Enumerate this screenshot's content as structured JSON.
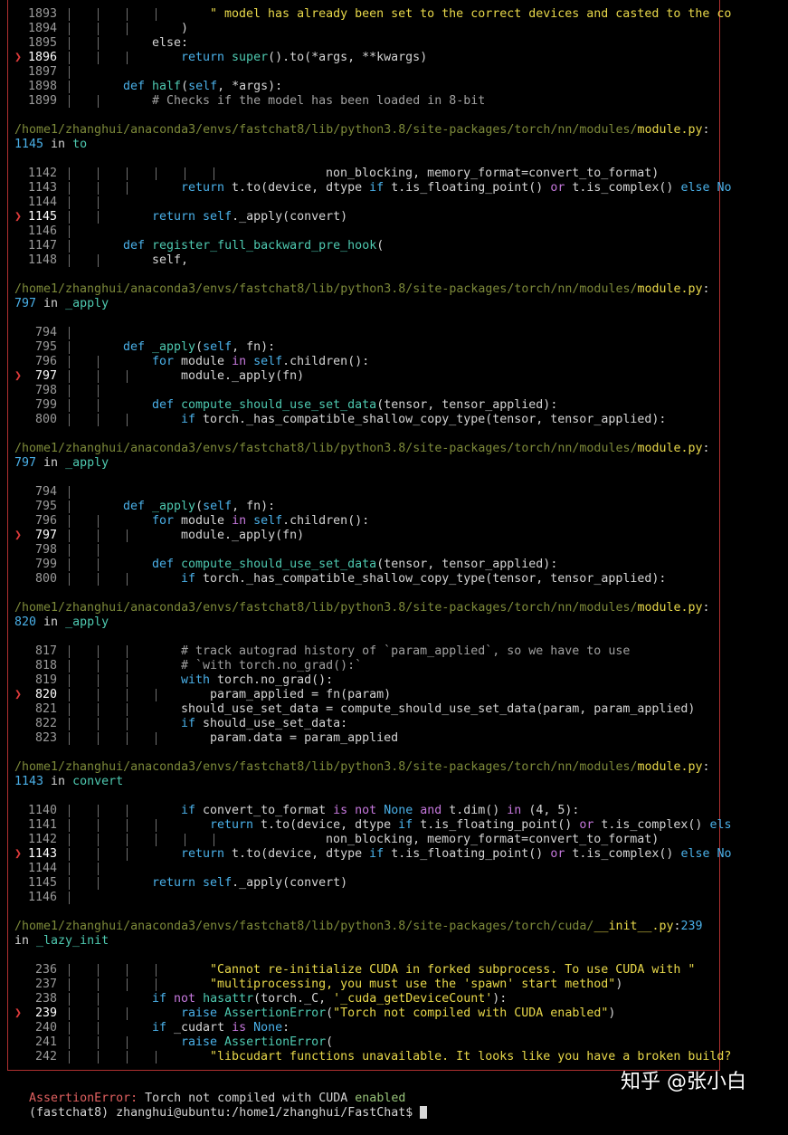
{
  "colors": {
    "background": "#000000",
    "frame": "#b03030",
    "path": "#7d8a3a",
    "filename": "#e8d84a",
    "keyword": "#4ab0e8",
    "error": "#e06060"
  },
  "frames": [
    {
      "lines": [
        {
          "n": "1893",
          "cur": false,
          "depth": 4,
          "indent": 20,
          "code": [
            [
              "\" model has already been set to the correct devices and casted to the co",
              "str"
            ]
          ]
        },
        {
          "n": "1894",
          "cur": false,
          "depth": 3,
          "indent": 16,
          "code": [
            [
              ")",
              ""
            ]
          ]
        },
        {
          "n": "1895",
          "cur": false,
          "depth": 2,
          "indent": 12,
          "code": [
            [
              "else",
              ""
            ],
            [
              ":",
              ""
            ]
          ]
        },
        {
          "n": "1896",
          "cur": true,
          "depth": 3,
          "indent": 16,
          "code": [
            [
              "return ",
              "kw"
            ],
            [
              "super",
              "fn"
            ],
            [
              "().to(*args, **kwargs)",
              ""
            ]
          ]
        },
        {
          "n": "1897",
          "cur": false,
          "depth": 1,
          "indent": 0,
          "code": []
        },
        {
          "n": "1898",
          "cur": false,
          "depth": 1,
          "indent": 8,
          "code": [
            [
              "def ",
              "kw"
            ],
            [
              "half",
              "fn"
            ],
            [
              "(",
              ""
            ],
            [
              "self",
              "kw"
            ],
            [
              ", *args):",
              ""
            ]
          ]
        },
        {
          "n": "1899",
          "cur": false,
          "depth": 2,
          "indent": 12,
          "code": [
            [
              "# Checks if the model has been loaded in 8-bit",
              "cmt"
            ]
          ]
        }
      ]
    },
    {
      "path": "/home1/zhanghui/anaconda3/envs/fastchat8/lib/python3.8/site-packages/torch/nn/modules/",
      "file": "module.py",
      "lineno": "1145",
      "func": "to",
      "lines": [
        {
          "n": "1142",
          "cur": false,
          "depth": 6,
          "indent": 36,
          "code": [
            [
              "non_blocking, memory_format=convert_to_format)",
              ""
            ]
          ]
        },
        {
          "n": "1143",
          "cur": false,
          "depth": 3,
          "indent": 16,
          "code": [
            [
              "return ",
              "kw"
            ],
            [
              "t.to(device, dtype ",
              ""
            ],
            [
              "if ",
              "kw"
            ],
            [
              "t.is_floating_point() ",
              ""
            ],
            [
              "or ",
              "kwp"
            ],
            [
              "t.is_complex() ",
              ""
            ],
            [
              "else No",
              "kw"
            ]
          ]
        },
        {
          "n": "1144",
          "cur": false,
          "depth": 2,
          "indent": 0,
          "code": []
        },
        {
          "n": "1145",
          "cur": true,
          "depth": 2,
          "indent": 12,
          "code": [
            [
              "return ",
              "kw"
            ],
            [
              "self",
              "kw"
            ],
            [
              "._apply(convert)",
              ""
            ]
          ]
        },
        {
          "n": "1146",
          "cur": false,
          "depth": 1,
          "indent": 0,
          "code": []
        },
        {
          "n": "1147",
          "cur": false,
          "depth": 1,
          "indent": 8,
          "code": [
            [
              "def ",
              "kw"
            ],
            [
              "register_full_backward_pre_hook",
              "fn"
            ],
            [
              "(",
              ""
            ]
          ]
        },
        {
          "n": "1148",
          "cur": false,
          "depth": 2,
          "indent": 12,
          "code": [
            [
              "self",
              ""
            ],
            [
              ",",
              ""
            ]
          ]
        }
      ]
    },
    {
      "path": "/home1/zhanghui/anaconda3/envs/fastchat8/lib/python3.8/site-packages/torch/nn/modules/",
      "file": "module.py",
      "lineno": "797",
      "func": "_apply",
      "lines": [
        {
          "n": "794",
          "cur": false,
          "depth": 1,
          "indent": 0,
          "code": []
        },
        {
          "n": "795",
          "cur": false,
          "depth": 1,
          "indent": 8,
          "code": [
            [
              "def ",
              "kw"
            ],
            [
              "_apply",
              "fn"
            ],
            [
              "(",
              ""
            ],
            [
              "self",
              "kw"
            ],
            [
              ", fn):",
              ""
            ]
          ]
        },
        {
          "n": "796",
          "cur": false,
          "depth": 2,
          "indent": 12,
          "code": [
            [
              "for ",
              "kw"
            ],
            [
              "module ",
              ""
            ],
            [
              "in ",
              "kwp"
            ],
            [
              "self",
              "kw"
            ],
            [
              ".children():",
              ""
            ]
          ]
        },
        {
          "n": "797",
          "cur": true,
          "depth": 3,
          "indent": 16,
          "code": [
            [
              "module._apply(fn)",
              ""
            ]
          ]
        },
        {
          "n": "798",
          "cur": false,
          "depth": 2,
          "indent": 0,
          "code": []
        },
        {
          "n": "799",
          "cur": false,
          "depth": 2,
          "indent": 12,
          "code": [
            [
              "def ",
              "kw"
            ],
            [
              "compute_should_use_set_data",
              "fn"
            ],
            [
              "(tensor, tensor_applied):",
              ""
            ]
          ]
        },
        {
          "n": "800",
          "cur": false,
          "depth": 3,
          "indent": 16,
          "code": [
            [
              "if ",
              "kw"
            ],
            [
              "torch._has_compatible_shallow_copy_type(tensor, tensor_applied):",
              ""
            ]
          ]
        }
      ]
    },
    {
      "path": "/home1/zhanghui/anaconda3/envs/fastchat8/lib/python3.8/site-packages/torch/nn/modules/",
      "file": "module.py",
      "lineno": "797",
      "func": "_apply",
      "lines": [
        {
          "n": "794",
          "cur": false,
          "depth": 1,
          "indent": 0,
          "code": []
        },
        {
          "n": "795",
          "cur": false,
          "depth": 1,
          "indent": 8,
          "code": [
            [
              "def ",
              "kw"
            ],
            [
              "_apply",
              "fn"
            ],
            [
              "(",
              ""
            ],
            [
              "self",
              "kw"
            ],
            [
              ", fn):",
              ""
            ]
          ]
        },
        {
          "n": "796",
          "cur": false,
          "depth": 2,
          "indent": 12,
          "code": [
            [
              "for ",
              "kw"
            ],
            [
              "module ",
              ""
            ],
            [
              "in ",
              "kwp"
            ],
            [
              "self",
              "kw"
            ],
            [
              ".children():",
              ""
            ]
          ]
        },
        {
          "n": "797",
          "cur": true,
          "depth": 3,
          "indent": 16,
          "code": [
            [
              "module._apply(fn)",
              ""
            ]
          ]
        },
        {
          "n": "798",
          "cur": false,
          "depth": 2,
          "indent": 0,
          "code": []
        },
        {
          "n": "799",
          "cur": false,
          "depth": 2,
          "indent": 12,
          "code": [
            [
              "def ",
              "kw"
            ],
            [
              "compute_should_use_set_data",
              "fn"
            ],
            [
              "(tensor, tensor_applied):",
              ""
            ]
          ]
        },
        {
          "n": "800",
          "cur": false,
          "depth": 3,
          "indent": 16,
          "code": [
            [
              "if ",
              "kw"
            ],
            [
              "torch._has_compatible_shallow_copy_type(tensor, tensor_applied):",
              ""
            ]
          ]
        }
      ]
    },
    {
      "path": "/home1/zhanghui/anaconda3/envs/fastchat8/lib/python3.8/site-packages/torch/nn/modules/",
      "file": "module.py",
      "lineno": "820",
      "func": "_apply",
      "lines": [
        {
          "n": "817",
          "cur": false,
          "depth": 3,
          "indent": 16,
          "code": [
            [
              "# track autograd history of `param_applied`, so we have to use",
              "cmt"
            ]
          ]
        },
        {
          "n": "818",
          "cur": false,
          "depth": 3,
          "indent": 16,
          "code": [
            [
              "# `with torch.no_grad():`",
              "cmt"
            ]
          ]
        },
        {
          "n": "819",
          "cur": false,
          "depth": 3,
          "indent": 16,
          "code": [
            [
              "with ",
              "kw"
            ],
            [
              "torch.no_grad():",
              ""
            ]
          ]
        },
        {
          "n": "820",
          "cur": true,
          "depth": 4,
          "indent": 20,
          "code": [
            [
              "param_applied = fn(param)",
              ""
            ]
          ]
        },
        {
          "n": "821",
          "cur": false,
          "depth": 3,
          "indent": 16,
          "code": [
            [
              "should_use_set_data = compute_should_use_set_data(param, param_applied)",
              ""
            ]
          ]
        },
        {
          "n": "822",
          "cur": false,
          "depth": 3,
          "indent": 16,
          "code": [
            [
              "if ",
              "kw"
            ],
            [
              "should_use_set_data:",
              ""
            ]
          ]
        },
        {
          "n": "823",
          "cur": false,
          "depth": 4,
          "indent": 20,
          "code": [
            [
              "param.data = param_applied",
              ""
            ]
          ]
        }
      ]
    },
    {
      "path": "/home1/zhanghui/anaconda3/envs/fastchat8/lib/python3.8/site-packages/torch/nn/modules/",
      "file": "module.py",
      "lineno": "1143",
      "func": "convert",
      "lines": [
        {
          "n": "1140",
          "cur": false,
          "depth": 3,
          "indent": 16,
          "code": [
            [
              "if ",
              "kw"
            ],
            [
              "convert_to_format ",
              ""
            ],
            [
              "is not ",
              "kwp"
            ],
            [
              "None ",
              "kw"
            ],
            [
              "and ",
              "kwp"
            ],
            [
              "t.dim() ",
              ""
            ],
            [
              "in ",
              "kwp"
            ],
            [
              "(",
              ""
            ],
            [
              "4",
              ""
            ],
            [
              ", ",
              ""
            ],
            [
              "5",
              ""
            ],
            [
              "):",
              ""
            ]
          ]
        },
        {
          "n": "1141",
          "cur": false,
          "depth": 4,
          "indent": 20,
          "code": [
            [
              "return ",
              "kw"
            ],
            [
              "t.to(device, dtype ",
              ""
            ],
            [
              "if ",
              "kw"
            ],
            [
              "t.is_floating_point() ",
              ""
            ],
            [
              "or ",
              "kwp"
            ],
            [
              "t.is_complex() ",
              ""
            ],
            [
              "els",
              "kw"
            ]
          ]
        },
        {
          "n": "1142",
          "cur": false,
          "depth": 6,
          "indent": 36,
          "code": [
            [
              "non_blocking, memory_format=convert_to_format)",
              ""
            ]
          ]
        },
        {
          "n": "1143",
          "cur": true,
          "depth": 3,
          "indent": 16,
          "code": [
            [
              "return ",
              "kw"
            ],
            [
              "t.to(device, dtype ",
              ""
            ],
            [
              "if ",
              "kw"
            ],
            [
              "t.is_floating_point() ",
              ""
            ],
            [
              "or ",
              "kwp"
            ],
            [
              "t.is_complex() ",
              ""
            ],
            [
              "else No",
              "kw"
            ]
          ]
        },
        {
          "n": "1144",
          "cur": false,
          "depth": 2,
          "indent": 0,
          "code": []
        },
        {
          "n": "1145",
          "cur": false,
          "depth": 2,
          "indent": 12,
          "code": [
            [
              "return ",
              "kw"
            ],
            [
              "self",
              "kw"
            ],
            [
              "._apply(convert)",
              ""
            ]
          ]
        },
        {
          "n": "1146",
          "cur": false,
          "depth": 1,
          "indent": 0,
          "code": []
        }
      ]
    },
    {
      "path": "/home1/zhanghui/anaconda3/envs/fastchat8/lib/python3.8/site-packages/torch/cuda/",
      "file": "__init__.py",
      "lineno": "239",
      "func": "_lazy_init",
      "lines": [
        {
          "n": "236",
          "cur": false,
          "depth": 4,
          "indent": 20,
          "code": [
            [
              "\"Cannot re-initialize CUDA in forked subprocess. To use CUDA with \"",
              "str"
            ]
          ]
        },
        {
          "n": "237",
          "cur": false,
          "depth": 4,
          "indent": 20,
          "code": [
            [
              "\"multiprocessing, you must use the 'spawn' start method\"",
              "str"
            ],
            [
              ")",
              ""
            ]
          ]
        },
        {
          "n": "238",
          "cur": false,
          "depth": 2,
          "indent": 12,
          "code": [
            [
              "if ",
              "kw"
            ],
            [
              "not ",
              "kwp"
            ],
            [
              "hasattr",
              "fn"
            ],
            [
              "(torch._C, ",
              ""
            ],
            [
              "'_cuda_getDeviceCount'",
              "str"
            ],
            [
              "):",
              ""
            ]
          ]
        },
        {
          "n": "239",
          "cur": true,
          "depth": 3,
          "indent": 16,
          "code": [
            [
              "raise ",
              "kw"
            ],
            [
              "AssertionError",
              "fn"
            ],
            [
              "(",
              ""
            ],
            [
              "\"Torch not compiled with CUDA enabled\"",
              "str"
            ],
            [
              ")",
              ""
            ]
          ]
        },
        {
          "n": "240",
          "cur": false,
          "depth": 2,
          "indent": 12,
          "code": [
            [
              "if ",
              "kw"
            ],
            [
              "_cudart ",
              ""
            ],
            [
              "is ",
              "kwp"
            ],
            [
              "None",
              "kw"
            ],
            [
              ":",
              ""
            ]
          ]
        },
        {
          "n": "241",
          "cur": false,
          "depth": 3,
          "indent": 16,
          "code": [
            [
              "raise ",
              "kw"
            ],
            [
              "AssertionError",
              "fn"
            ],
            [
              "(",
              ""
            ]
          ]
        },
        {
          "n": "242",
          "cur": false,
          "depth": 4,
          "indent": 20,
          "code": [
            [
              "\"libcudart functions unavailable. It looks like you have a broken build?",
              "str"
            ]
          ]
        }
      ]
    }
  ],
  "in_word": "in",
  "error": {
    "type": "AssertionError:",
    "message": " Torch not compiled with CUDA ",
    "highlight": "enabled"
  },
  "prompt": {
    "text": "(fastchat8) zhanghui@ubuntu:/home1/zhanghui/FastChat$ "
  },
  "watermark": "知乎 @张小白"
}
